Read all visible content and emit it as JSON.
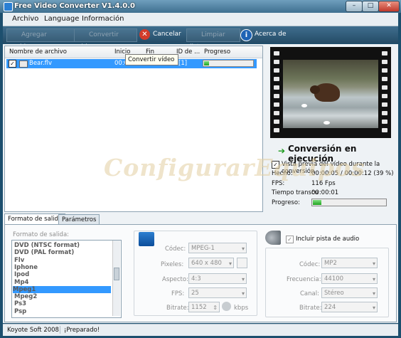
{
  "window": {
    "title": "Free Video Converter V1.4.0.0"
  },
  "menu": [
    "Archivo",
    "Language",
    "Información"
  ],
  "toolbar": {
    "add": "Agregar archivos",
    "convert": "Convertir video",
    "cancel": "Cancelar",
    "clear": "Limpiar lista",
    "about": "Acerca de"
  },
  "filelist": {
    "columns": [
      "Nombre de archivo",
      "Inicio",
      "Fin",
      "ID de ...",
      "Progreso"
    ],
    "rows": [
      {
        "checked": true,
        "name": "Bear.flv",
        "start": "00:0",
        "id": "[1]",
        "progress": 0.1
      }
    ],
    "tooltip": "Convertir vídeo"
  },
  "preview": {
    "status": "Conversión en ejecución",
    "preview_checkbox": "Vista previa del vídeo durante la conversión",
    "done_label": "Hecho:",
    "done_value": "00:00:05 / 00:00:12  (39 %)",
    "fps_label": "FPS:",
    "fps_value": "116 Fps",
    "elapsed_label": "Tiempo transcu",
    "elapsed_value": "00:00:01",
    "progress_label": "Progreso:",
    "progress": 0.12
  },
  "watermark": "ConfigurarEquipos",
  "tabs": [
    "Formato de salida",
    "Parámetros"
  ],
  "output_format": {
    "label": "Formato de salida:",
    "items": [
      "DVD (NTSC format)",
      "DVD (PAL format)",
      "Flv",
      "Iphone",
      "Ipod",
      "Mp4",
      "Mpeg1",
      "Mpeg2",
      "Ps3",
      "Psp"
    ],
    "selected_index": 6
  },
  "video": {
    "codec_label": "Códec:",
    "codec": "MPEG-1",
    "pixels_label": "Pixeles:",
    "pixels": "640 x 480",
    "aspect_label": "Aspecto:",
    "aspect": "4:3",
    "fps_label": "FPS:",
    "fps": "25",
    "bitrate_label": "Bitrate:",
    "bitrate": "1152",
    "bitrate_unit": "kbps"
  },
  "audio": {
    "include_label": "Incluir pista de audio",
    "codec_label": "Códec:",
    "codec": "MP2",
    "freq_label": "Frecuencia:",
    "freq": "44100",
    "channel_label": "Canal:",
    "channel": "Stéreo",
    "bitrate_label": "Bitrate:",
    "bitrate": "224"
  },
  "statusbar": {
    "company": "Koyote Soft 2008",
    "state": "¡Preparado!"
  },
  "colors": {
    "selection": "#3399ff",
    "progress": "#1fa21f",
    "toolbar": "#2f5a78"
  }
}
